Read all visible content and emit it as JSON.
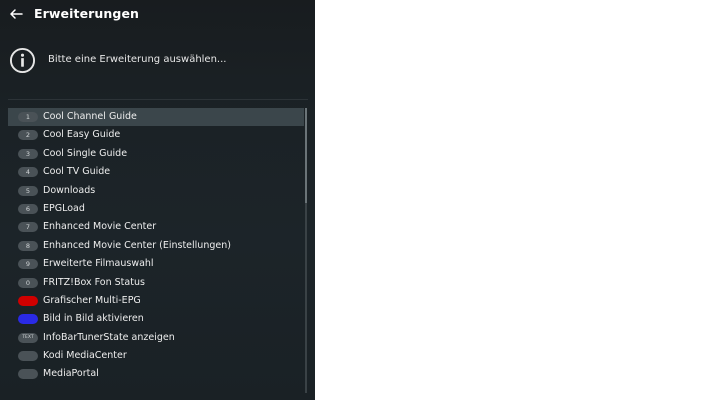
{
  "header": {
    "title": "Erweiterungen",
    "back_icon": "arrow-left-icon"
  },
  "info": {
    "icon": "info-icon",
    "text": "Bitte eine Erweiterung auswählen..."
  },
  "items": [
    {
      "badge": "1",
      "label": "Cool Channel Guide",
      "selected": true
    },
    {
      "badge": "2",
      "label": "Cool Easy Guide"
    },
    {
      "badge": "3",
      "label": "Cool Single Guide"
    },
    {
      "badge": "4",
      "label": "Cool TV Guide"
    },
    {
      "badge": "5",
      "label": "Downloads"
    },
    {
      "badge": "6",
      "label": "EPGLoad"
    },
    {
      "badge": "7",
      "label": "Enhanced Movie Center"
    },
    {
      "badge": "8",
      "label": "Enhanced Movie Center (Einstellungen)"
    },
    {
      "badge": "9",
      "label": "Erweiterte Filmauswahl"
    },
    {
      "badge": "0",
      "label": "FRITZ!Box Fon Status"
    },
    {
      "badge": "",
      "label": "Grafischer Multi-EPG",
      "badge_color": "#d00000"
    },
    {
      "badge": "",
      "label": "Bild in Bild aktivieren",
      "badge_color": "#2a2ae6"
    },
    {
      "badge": "TEXT",
      "label": "InfoBarTunerState anzeigen"
    },
    {
      "badge": "",
      "label": "Kodi MediaCenter"
    },
    {
      "badge": "",
      "label": "MediaPortal"
    }
  ],
  "colors": {
    "background": "#1b2226",
    "selected_row": "#3b464b",
    "red_key": "#d00000",
    "blue_key": "#2a2ae6"
  }
}
